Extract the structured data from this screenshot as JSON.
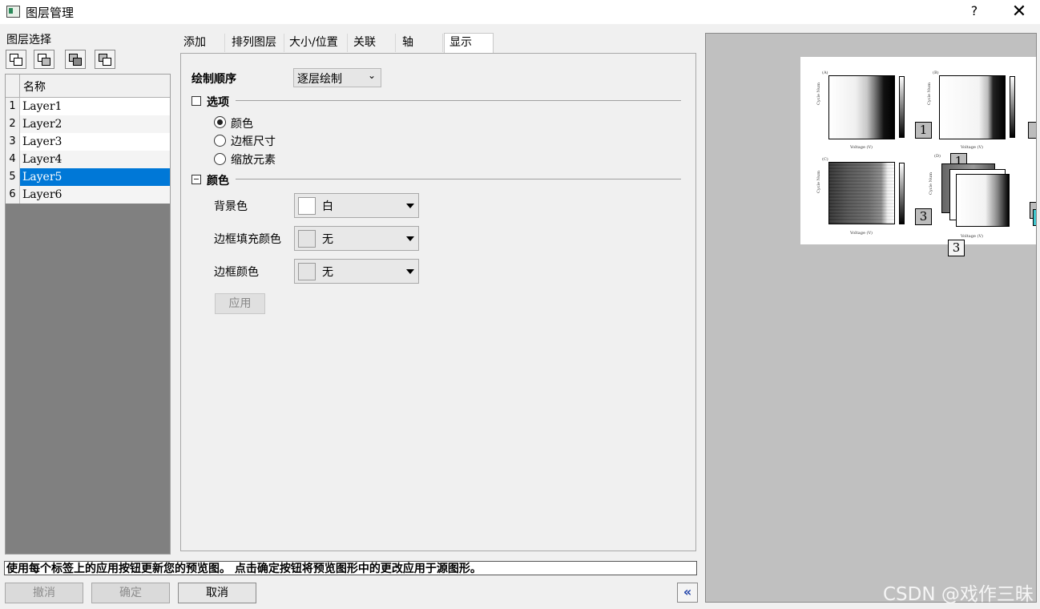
{
  "window": {
    "title": "图层管理",
    "help": "?",
    "close": "✕"
  },
  "layer_select": {
    "label": "图层选择",
    "column_header": "名称",
    "rows": [
      {
        "idx": "1",
        "name": "Layer1"
      },
      {
        "idx": "2",
        "name": "Layer2"
      },
      {
        "idx": "3",
        "name": "Layer3"
      },
      {
        "idx": "4",
        "name": "Layer4"
      },
      {
        "idx": "5",
        "name": "Layer5",
        "selected": true
      },
      {
        "idx": "6",
        "name": "Layer6"
      }
    ]
  },
  "tabs": [
    "添加",
    "排列图层",
    "大小/位置",
    "关联",
    "轴",
    "显示"
  ],
  "active_tab": "显示",
  "display": {
    "draw_order_label": "绘制顺序",
    "draw_order_value": "逐层绘制",
    "options_section": "选项",
    "radio_color": "颜色",
    "radio_frame_size": "边框尺寸",
    "radio_scale": "缩放元素",
    "color_section": "颜色",
    "bg_label": "背景色",
    "bg_value": "白",
    "frame_fill_label": "边框填充颜色",
    "frame_fill_value": "无",
    "frame_color_label": "边框颜色",
    "frame_color_value": "无",
    "apply": "应用"
  },
  "hint": "使用每个标签上的应用按钮更新您的预览图。 点击确定按钮将预览图形中的更改应用于源图形。",
  "buttons": {
    "undo": "撤消",
    "ok": "确定",
    "cancel": "取消",
    "collapse": "«"
  },
  "preview": {
    "panel_a": "(A)",
    "panel_b": "(B)",
    "panel_c": "(C)",
    "panel_d": "(D)",
    "xlabel": "Voltage (V)",
    "ylabel": "Cycle Num",
    "badges": [
      "1",
      "1",
      "3",
      "3"
    ]
  },
  "watermark": "CSDN @戏作三昧",
  "colors": {
    "selected_row": "#0078d7",
    "preview_bg": "#c0c0c0"
  }
}
